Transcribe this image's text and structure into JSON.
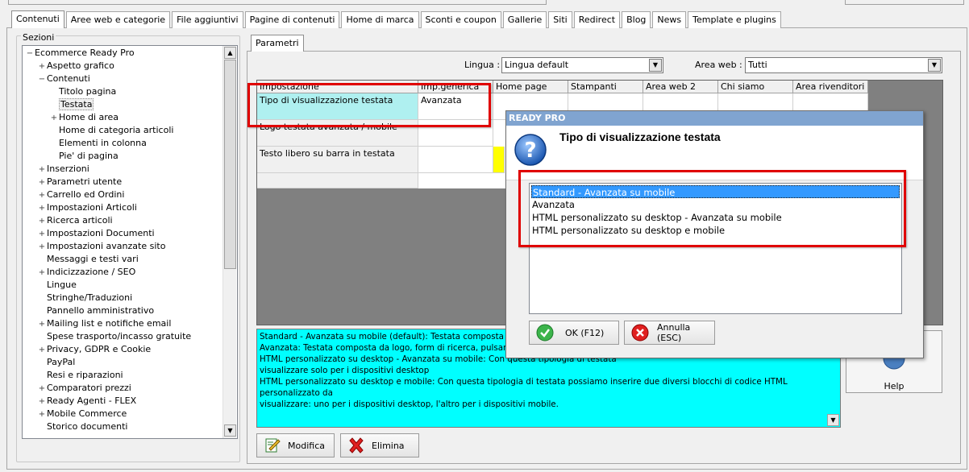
{
  "main_tabs": [
    "Contenuti",
    "Aree web e categorie",
    "File aggiuntivi",
    "Pagine di contenuti",
    "Home di marca",
    "Sconti e coupon",
    "Gallerie",
    "Siti",
    "Redirect",
    "Blog",
    "News",
    "Template e plugins"
  ],
  "sidebar": {
    "title": "Sezioni",
    "items": [
      {
        "label": "Ecommerce Ready Pro",
        "level": 0,
        "exp": "−"
      },
      {
        "label": "Aspetto grafico",
        "level": 1,
        "exp": "+"
      },
      {
        "label": "Contenuti",
        "level": 1,
        "exp": "−"
      },
      {
        "label": "Titolo pagina",
        "level": 2,
        "exp": ""
      },
      {
        "label": "Testata",
        "level": 2,
        "exp": "",
        "selected": true
      },
      {
        "label": "Home di area",
        "level": 2,
        "exp": "+"
      },
      {
        "label": "Home di categoria articoli",
        "level": 2,
        "exp": ""
      },
      {
        "label": "Elementi in colonna",
        "level": 2,
        "exp": ""
      },
      {
        "label": "Pie' di pagina",
        "level": 2,
        "exp": ""
      },
      {
        "label": "Inserzioni",
        "level": 1,
        "exp": "+"
      },
      {
        "label": "Parametri utente",
        "level": 1,
        "exp": "+"
      },
      {
        "label": "Carrello ed Ordini",
        "level": 1,
        "exp": "+"
      },
      {
        "label": "Impostazioni Articoli",
        "level": 1,
        "exp": "+"
      },
      {
        "label": "Ricerca articoli",
        "level": 1,
        "exp": "+"
      },
      {
        "label": "Impostazioni Documenti",
        "level": 1,
        "exp": "+"
      },
      {
        "label": "Impostazioni avanzate sito",
        "level": 1,
        "exp": "+"
      },
      {
        "label": "Messaggi e testi vari",
        "level": 1,
        "exp": ""
      },
      {
        "label": "Indicizzazione / SEO",
        "level": 1,
        "exp": "+"
      },
      {
        "label": "Lingue",
        "level": 1,
        "exp": ""
      },
      {
        "label": "Stringhe/Traduzioni",
        "level": 1,
        "exp": ""
      },
      {
        "label": "Pannello amministrativo",
        "level": 1,
        "exp": ""
      },
      {
        "label": "Mailing list e notifiche email",
        "level": 1,
        "exp": "+"
      },
      {
        "label": "Spese trasporto/incasso gratuite",
        "level": 1,
        "exp": ""
      },
      {
        "label": "Privacy, GDPR e Cookie",
        "level": 1,
        "exp": "+"
      },
      {
        "label": "PayPal",
        "level": 1,
        "exp": ""
      },
      {
        "label": "Resi e riparazioni",
        "level": 1,
        "exp": ""
      },
      {
        "label": "Comparatori prezzi",
        "level": 1,
        "exp": "+"
      },
      {
        "label": "Ready Agenti - FLEX",
        "level": 1,
        "exp": "+"
      },
      {
        "label": "Mobile Commerce",
        "level": 1,
        "exp": "+"
      },
      {
        "label": "Storico documenti",
        "level": 1,
        "exp": ""
      }
    ]
  },
  "params_tab": "Parametri",
  "filters": {
    "lingua_label": "Lingua :",
    "lingua_value": "Lingua default",
    "area_label": "Area web :",
    "area_value": "Tutti"
  },
  "grid": {
    "headers": [
      "Impostazione",
      "Imp.generica",
      "Home page",
      "Stampanti",
      "Area web 2",
      "Chi siamo",
      "Area rivenditori"
    ],
    "rows": [
      {
        "name": "Tipo di visualizzazione testata",
        "value": "Avanzata"
      },
      {
        "name": "Logo testata avanzata / mobile",
        "value": ""
      },
      {
        "name": "Testo libero su barra in testata",
        "value": ""
      }
    ]
  },
  "description": {
    "lines": [
      "Standard - Avanzata su mobile (default): Testata composta da lo",
      "Avanzata: Testata composta da logo, form di ricerca, pulsante lo",
      "HTML personalizzato su desktop - Avanzata su mobile: Con questa tipologia di testata",
      "visualizzare solo per i dispositivi desktop",
      "HTML personalizzato su desktop e mobile: Con questa tipologia di testata possiamo inserire due diversi blocchi di codice HTML personalizzato da",
      "visualizzare: uno per i dispositivi desktop, l'altro per i dispositivi mobile."
    ]
  },
  "buttons": {
    "modifica": "Modifica",
    "elimina": "Elimina",
    "help": "Help"
  },
  "dialog": {
    "title": "READY PRO",
    "heading": "Tipo di visualizzazione testata",
    "options": [
      "Standard - Avanzata su mobile",
      "Avanzata",
      "HTML personalizzato su desktop - Avanzata su mobile",
      "HTML personalizzato su desktop e mobile"
    ],
    "selected_index": 0,
    "ok_label": "OK (F12)",
    "cancel_label": "Annulla (ESC)"
  },
  "colors": {
    "highlight": "#e00000",
    "description_bg": "#00ffff",
    "selection": "#3399ff",
    "cell_highlight": "#aff0f0",
    "yellow": "#ffff00"
  }
}
